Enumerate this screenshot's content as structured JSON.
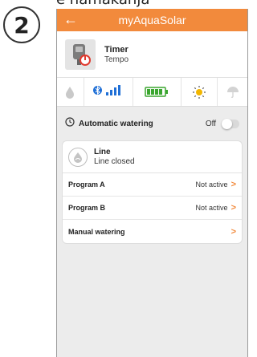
{
  "caption": "e namakanja",
  "step_number": "2",
  "appbar": {
    "back_icon": "arrow-left-icon",
    "title": "myAquaSolar"
  },
  "device": {
    "name": "Timer",
    "model": "Tempo"
  },
  "status_icons": [
    "drop-icon",
    "bluetooth-icon",
    "signal-bars-icon",
    "battery-icon",
    "sun-icon",
    "umbrella-icon"
  ],
  "auto_watering": {
    "label": "Automatic watering",
    "state": "Off",
    "icon": "clock-icon"
  },
  "line": {
    "title": "Line",
    "status": "Line closed",
    "icon": "water-drop-icon"
  },
  "programs": [
    {
      "name": "Program A",
      "status": "Not active"
    },
    {
      "name": "Program B",
      "status": "Not active"
    },
    {
      "name": "Manual watering",
      "status": ""
    }
  ],
  "chevron_glyph": ">",
  "colors": {
    "accent": "#f28a3c",
    "bluetooth": "#1f6fd6",
    "battery": "#3aa62f",
    "sun": "#f2b600"
  }
}
